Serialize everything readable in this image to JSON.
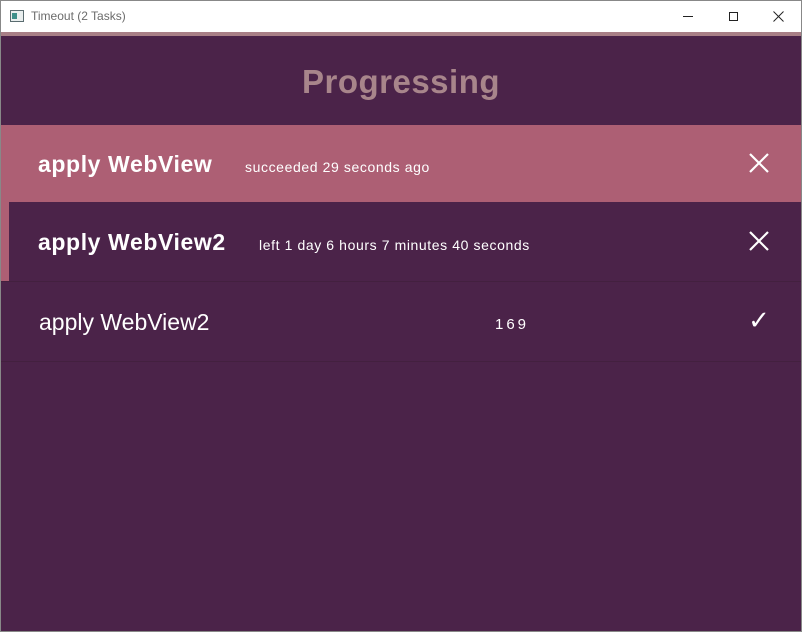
{
  "window": {
    "title": "Timeout (2 Tasks)",
    "icons": {
      "app": "app-window-icon",
      "minimize": "minimize-icon",
      "maximize": "maximize-icon",
      "close": "close-icon"
    }
  },
  "colors": {
    "background": "#4b2349",
    "accent": "#ad5f74",
    "heading": "#a8858b",
    "text": "#ffffff"
  },
  "main": {
    "heading": "Progressing",
    "tasks": [
      {
        "title": "apply WebView",
        "status": "succeeded 29 seconds ago",
        "action_icon": "close-icon"
      },
      {
        "title": "apply WebView2",
        "status": "left 1 day 6 hours 7 minutes 40 seconds",
        "action_icon": "close-icon"
      },
      {
        "title": "apply WebView2",
        "counter": "169",
        "action_icon": "checkmark-icon",
        "action_glyph": "✓"
      }
    ]
  }
}
